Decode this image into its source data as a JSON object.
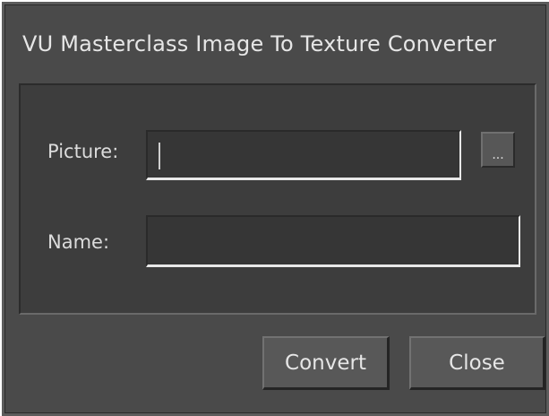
{
  "window": {
    "title": "VU Masterclass Image To Texture Converter"
  },
  "form": {
    "picture_label": "Picture:",
    "picture_value": "",
    "browse_label": "...",
    "name_label": "Name:",
    "name_value": ""
  },
  "buttons": {
    "convert_label": "Convert",
    "close_label": "Close"
  }
}
